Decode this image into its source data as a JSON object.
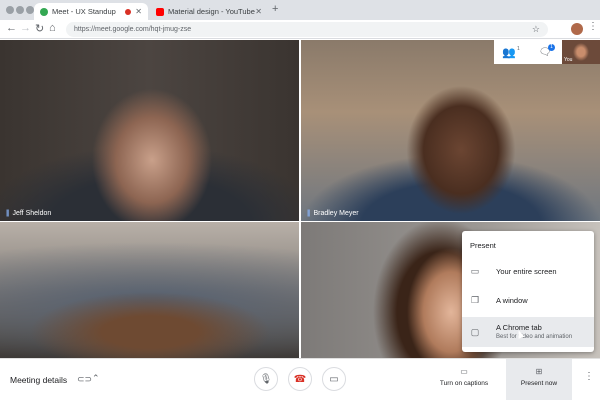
{
  "browser": {
    "tabs": [
      {
        "title": "Meet - UX Standup",
        "active": true,
        "recording": true
      },
      {
        "title": "Material design - YouTube",
        "active": false
      }
    ],
    "new_tab_icon": "plus-icon",
    "url": "https://meet.google.com/hqt-jmug-zse"
  },
  "meeting": {
    "participants": [
      {
        "name": "Jeff Sheldon"
      },
      {
        "name": "Bradley Meyer"
      }
    ],
    "participant_count_badge": "1",
    "chat_badge": "1",
    "self_label": "You"
  },
  "present_menu": {
    "title": "Present",
    "items": [
      {
        "label": "Your entire screen",
        "icon": "monitor-icon"
      },
      {
        "label": "A window",
        "icon": "window-icon"
      },
      {
        "label": "A Chrome tab",
        "sub": "Best for video and animation",
        "icon": "tab-icon",
        "highlighted": true
      }
    ]
  },
  "bottom_bar": {
    "meeting_details": "Meeting details",
    "captions_label": "Turn on captions",
    "present_label": "Present now"
  },
  "colors": {
    "hangup": "#d93025",
    "accent": "#1a73e8",
    "recording": "#d93025"
  }
}
